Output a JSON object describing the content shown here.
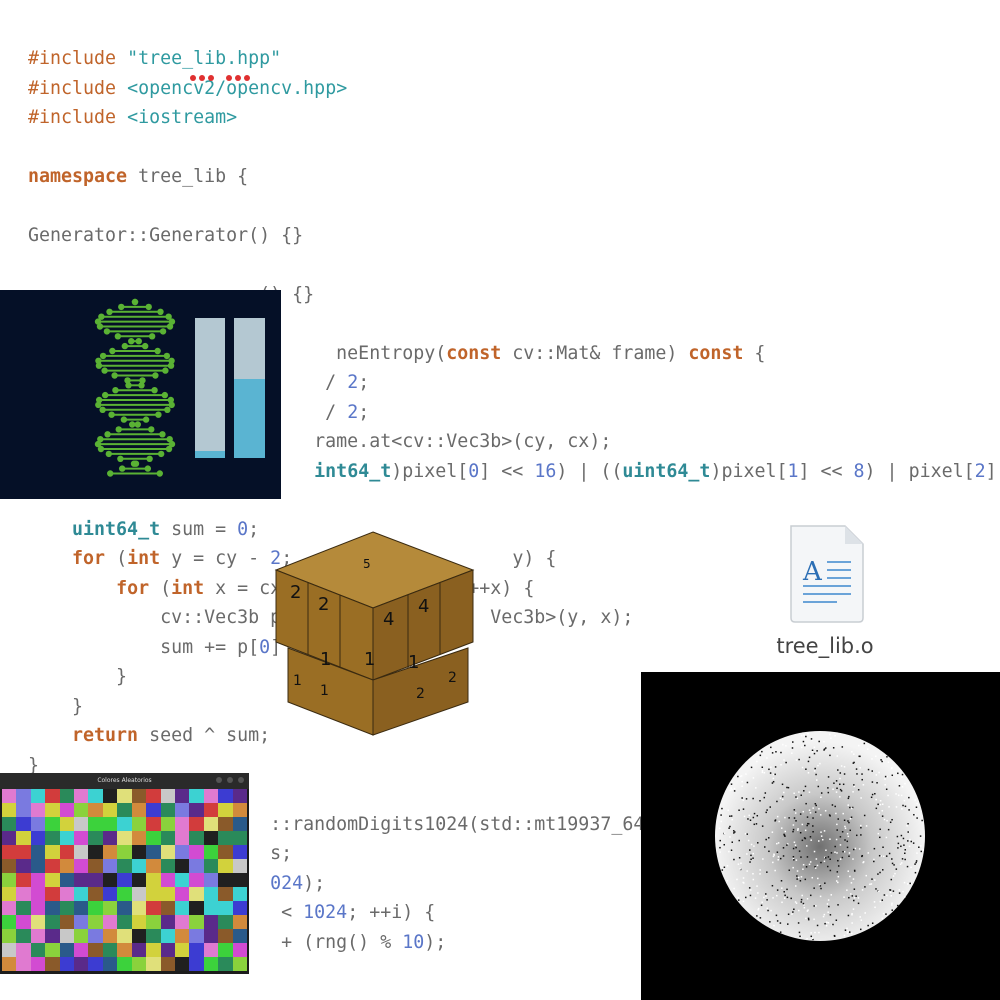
{
  "code": {
    "l1_pp": "#include",
    "l1_str": "\"tree_lib.hpp\"",
    "l2_pp": "#include",
    "l2_str": "<opencv2/opencv.hpp>",
    "l3_pp": "#include",
    "l3_str": "<iostream>",
    "l5_kw": "namespace",
    "l5_rest": " tree_lib {",
    "l7": "Generator::Generator() {}",
    "l9": "                     () {}",
    "l11_a": "                            neEntropy(",
    "l11_kw1": "const",
    "l11_b": " cv::Mat& frame) ",
    "l11_kw2": "const",
    "l11_c": " {",
    "l12_a": "                           / ",
    "l12_num": "2",
    "l12_b": ";",
    "l13_a": "                           / ",
    "l13_num": "2",
    "l13_b": ";",
    "l14": "                          rame.at<cv::Vec3b>(cy, cx);",
    "l15_a": "                          ",
    "l15_tp1": "int64_t",
    "l15_b": ")pixel[",
    "l15_n1": "0",
    "l15_c": "] << ",
    "l15_n2": "16",
    "l15_d": ") | ((",
    "l15_tp2": "uint64_t",
    "l15_e": ")pixel[",
    "l15_n3": "1",
    "l15_f": "] << ",
    "l15_n4": "8",
    "l15_g": ") | pixel[",
    "l15_n5": "2",
    "l15_h": "];",
    "l17_ind": "    ",
    "l17_tp": "uint64_t",
    "l17_a": " sum = ",
    "l17_num": "0",
    "l17_b": ";",
    "l18_ind": "    ",
    "l18_kw": "for",
    "l18_a": " (",
    "l18_kw2": "int",
    "l18_b": " y = cy - ",
    "l18_num": "2",
    "l18_c": ";                    y) {",
    "l19_ind": "        ",
    "l19_kw": "for",
    "l19_a": " (",
    "l19_kw2": "int",
    "l19_b": " x = cx                 ++x) {",
    "l20": "            cv::Vec3b p =                 Vec3b>(y, x);",
    "l21_a": "            sum += p[",
    "l21_num": "0",
    "l21_b": "]",
    "l22": "        }",
    "l23": "    }",
    "l24_ind": "    ",
    "l24_kw": "return",
    "l24_rest": " seed ^ sum;",
    "l25": "}",
    "l27": "                      ::randomDigits1024(std::mt19937_64& r",
    "l28": "                      s;",
    "l29_a": "                      ",
    "l29_num": "024",
    "l29_b": ");",
    "l30_a": "                       < ",
    "l30_num": "1024",
    "l30_b": "; ++i) {",
    "l31_a": "                       + (rng() % ",
    "l31_num": "10",
    "l31_b": ");"
  },
  "file": {
    "name": "tree_lib.o",
    "icon": "text-document-icon"
  },
  "palette_window": {
    "title": "Colores Aleatorios"
  },
  "cube_digits": {
    "top": "5",
    "front": [
      "2",
      "2",
      "4",
      "4"
    ],
    "mid": [
      "1",
      "1",
      "1"
    ],
    "bottom": [
      "1",
      "1",
      "2",
      "2"
    ]
  },
  "colors": {
    "bg_dna": "#051027",
    "dna_green": "#5ab234",
    "bar_light": "#b4c8d2",
    "bar_blue": "#5ab4d2",
    "cube": "#a0762a"
  }
}
